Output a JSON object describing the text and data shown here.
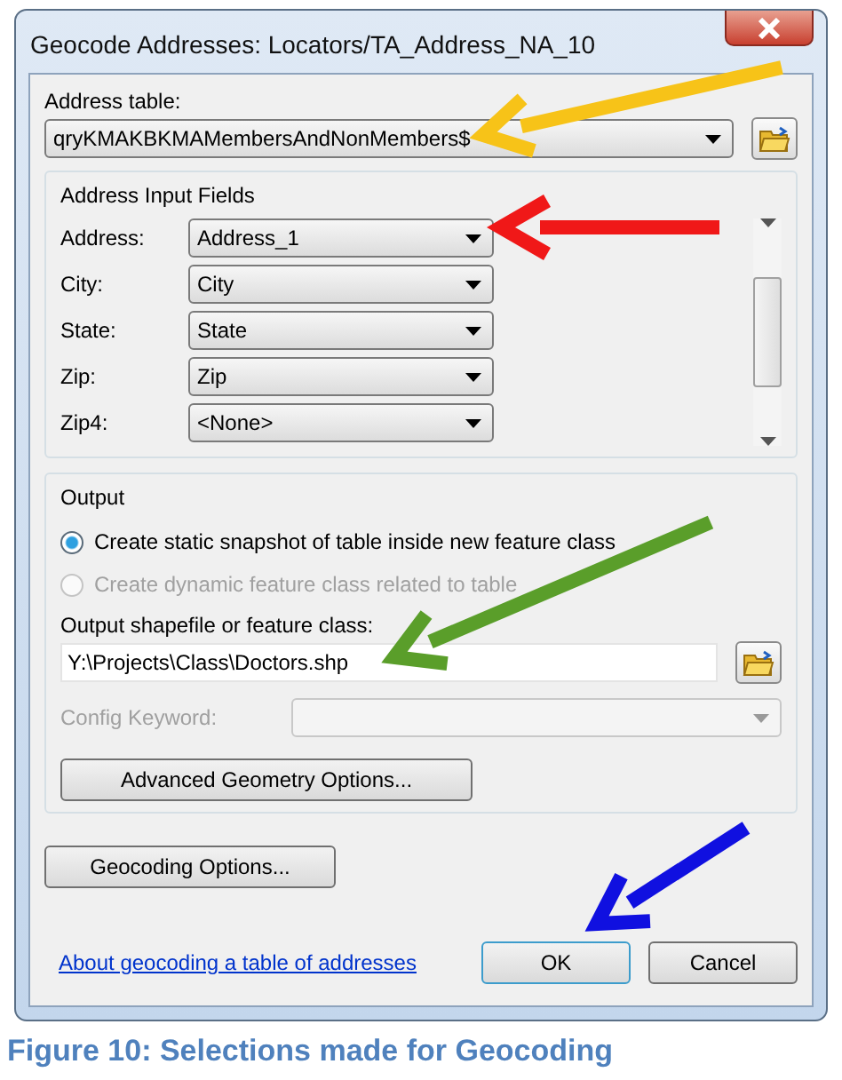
{
  "window": {
    "title": "Geocode Addresses:  Locators/TA_Address_NA_10"
  },
  "address_table": {
    "label": "Address table:",
    "value": "qryKMAKBKMAMembersAndNonMembers$"
  },
  "address_input_fields": {
    "title": "Address Input Fields",
    "fields": [
      {
        "label": "Address:",
        "value": "Address_1"
      },
      {
        "label": "City:",
        "value": "City"
      },
      {
        "label": "State:",
        "value": "State"
      },
      {
        "label": "Zip:",
        "value": "Zip"
      },
      {
        "label": "Zip4:",
        "value": "<None>"
      }
    ]
  },
  "output": {
    "title": "Output",
    "options": [
      {
        "label": "Create static snapshot of table inside new feature class",
        "selected": true,
        "disabled": false
      },
      {
        "label": "Create dynamic feature class related to table",
        "selected": false,
        "disabled": true
      }
    ],
    "shapefile_label": "Output shapefile or feature class:",
    "shapefile_value": "Y:\\Projects\\Class\\Doctors.shp",
    "config_label": "Config Keyword:",
    "advanced_button": "Advanced Geometry Options..."
  },
  "geocoding_options_button": "Geocoding Options...",
  "help_link": "About geocoding a table of addresses",
  "buttons": [
    "OK",
    "Cancel"
  ],
  "caption": "Figure 10: Selections made for Geocoding",
  "annotations": [
    {
      "color": "#f7c318"
    },
    {
      "color": "#f01818"
    },
    {
      "color": "#5a9e2a"
    },
    {
      "color": "#1010e0"
    }
  ]
}
